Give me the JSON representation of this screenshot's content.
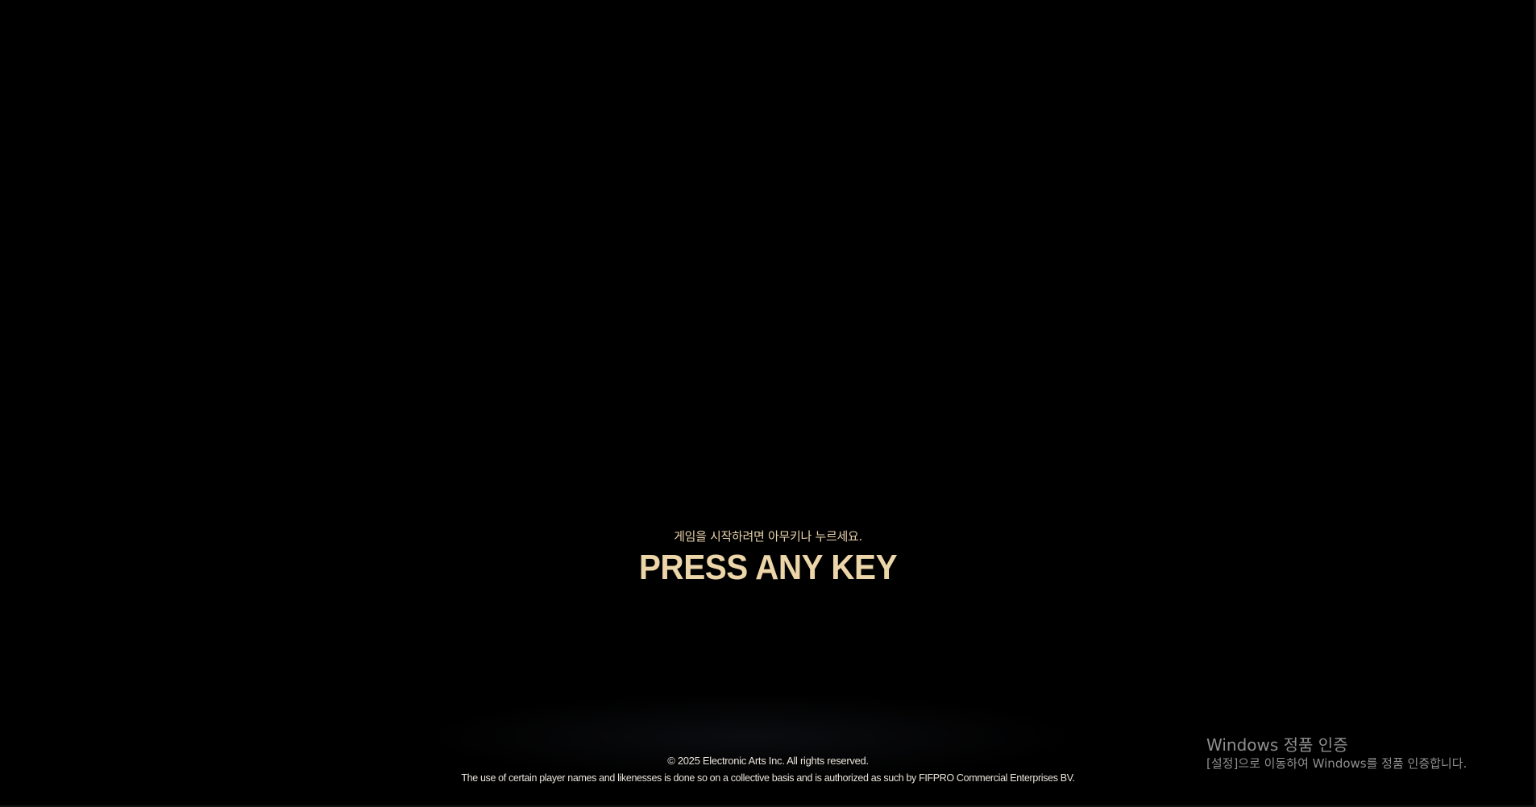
{
  "start_prompt": {
    "korean_hint": "게임을 시작하려면 아무키나 누르세요.",
    "main_label": "PRESS ANY KEY"
  },
  "legal": {
    "copyright": "© 2025 Electronic Arts Inc. All rights reserved.",
    "fifpro_notice": "The use of certain player names and likenesses is done so on a collective basis and is authorized as such by FIFPRO Commercial Enterprises BV."
  },
  "windows_activation": {
    "title": "Windows 정품 인증",
    "message": "[설정]으로 이동하여 Windows를 정품 인증합니다."
  },
  "colors": {
    "background": "#000000",
    "prompt_gold": "#ecd5a9",
    "legal_text": "#e8e3d8",
    "watermark_gray": "#8f8f8f"
  }
}
